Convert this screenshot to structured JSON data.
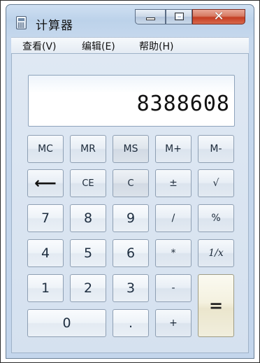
{
  "window": {
    "title": "计算器",
    "close_glyph": "✕"
  },
  "menu": {
    "items": [
      "查看(V)",
      "编辑(E)",
      "帮助(H)"
    ]
  },
  "display": {
    "value": "8388608"
  },
  "keys": {
    "mc": "MC",
    "mr": "MR",
    "ms": "MS",
    "mplus": "M+",
    "mminus": "M-",
    "backspace": "⟵",
    "ce": "CE",
    "c": "C",
    "plusminus": "±",
    "sqrt": "√",
    "seven": "7",
    "eight": "8",
    "nine": "9",
    "divide": "/",
    "percent": "%",
    "four": "4",
    "five": "5",
    "six": "6",
    "multiply": "*",
    "reciprocal": "1/x",
    "one": "1",
    "two": "2",
    "three": "3",
    "subtract": "-",
    "equals": "=",
    "zero": "0",
    "decimal": ".",
    "add": "+"
  },
  "icons": {
    "app": "calculator-icon",
    "minimize": "minimize-icon",
    "maximize": "maximize-icon",
    "close": "close-icon"
  }
}
